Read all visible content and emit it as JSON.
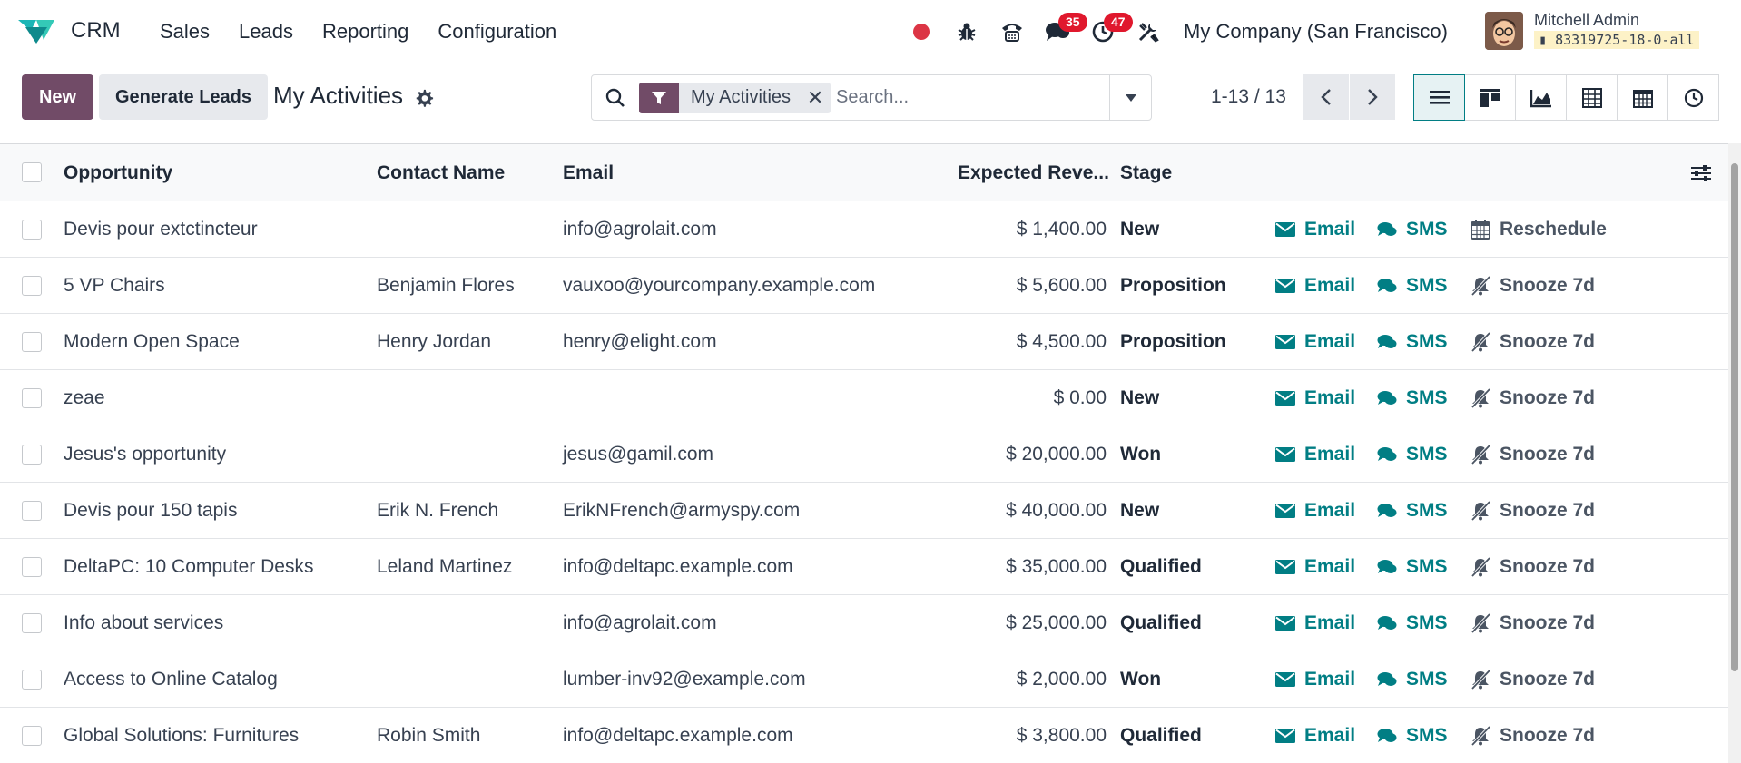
{
  "app": {
    "name": "CRM"
  },
  "menu": [
    "Sales",
    "Leads",
    "Reporting",
    "Configuration"
  ],
  "systray": {
    "messages_count": "35",
    "activities_count": "47",
    "company": "My Company (San Francisco)"
  },
  "user": {
    "name": "Mitchell Admin",
    "db": "83319725-18-0-all"
  },
  "control": {
    "new_label": "New",
    "generate_label": "Generate Leads",
    "title": "My Activities",
    "facet": "My Activities",
    "search_placeholder": "Search...",
    "pager": "1-13 / 13"
  },
  "views": [
    "list-icon",
    "kanban-icon",
    "graph-icon",
    "pivot-icon",
    "calendar-icon",
    "activity-icon"
  ],
  "columns": {
    "opportunity": "Opportunity",
    "contact": "Contact Name",
    "email": "Email",
    "revenue": "Expected Reve...",
    "stage": "Stage"
  },
  "actions": {
    "email": "Email",
    "sms": "SMS",
    "reschedule": "Reschedule",
    "snooze": "Snooze 7d"
  },
  "rows": [
    {
      "opportunity": "Devis pour extctincteur",
      "contact": "",
      "email": "info@agrolait.com",
      "revenue": "$ 1,400.00",
      "stage": "New",
      "third_action": "Reschedule"
    },
    {
      "opportunity": "5 VP Chairs",
      "contact": "Benjamin Flores",
      "email": "vauxoo@yourcompany.example.com",
      "revenue": "$ 5,600.00",
      "stage": "Proposition",
      "third_action": "Snooze 7d"
    },
    {
      "opportunity": "Modern Open Space",
      "contact": "Henry Jordan",
      "email": "henry@elight.com",
      "revenue": "$ 4,500.00",
      "stage": "Proposition",
      "third_action": "Snooze 7d"
    },
    {
      "opportunity": "zeae",
      "contact": "",
      "email": "",
      "revenue": "$ 0.00",
      "stage": "New",
      "third_action": "Snooze 7d"
    },
    {
      "opportunity": "Jesus's opportunity",
      "contact": "",
      "email": "jesus@gamil.com",
      "revenue": "$ 20,000.00",
      "stage": "Won",
      "third_action": "Snooze 7d"
    },
    {
      "opportunity": "Devis pour 150 tapis",
      "contact": "Erik N. French",
      "email": "ErikNFrench@armyspy.com",
      "revenue": "$ 40,000.00",
      "stage": "New",
      "third_action": "Snooze 7d"
    },
    {
      "opportunity": "DeltaPC: 10 Computer Desks",
      "contact": "Leland Martinez",
      "email": "info@deltapc.example.com",
      "revenue": "$ 35,000.00",
      "stage": "Qualified",
      "third_action": "Snooze 7d"
    },
    {
      "opportunity": "Info about services",
      "contact": "",
      "email": "info@agrolait.com",
      "revenue": "$ 25,000.00",
      "stage": "Qualified",
      "third_action": "Snooze 7d"
    },
    {
      "opportunity": "Access to Online Catalog",
      "contact": "",
      "email": "lumber-inv92@example.com",
      "revenue": "$ 2,000.00",
      "stage": "Won",
      "third_action": "Snooze 7d"
    },
    {
      "opportunity": "Global Solutions: Furnitures",
      "contact": "Robin Smith",
      "email": "info@deltapc.example.com",
      "revenue": "$ 3,800.00",
      "stage": "Qualified",
      "third_action": "Snooze 7d"
    }
  ],
  "colors": {
    "brand": "#714b67",
    "accent": "#017e84",
    "badge": "#e0182d"
  }
}
